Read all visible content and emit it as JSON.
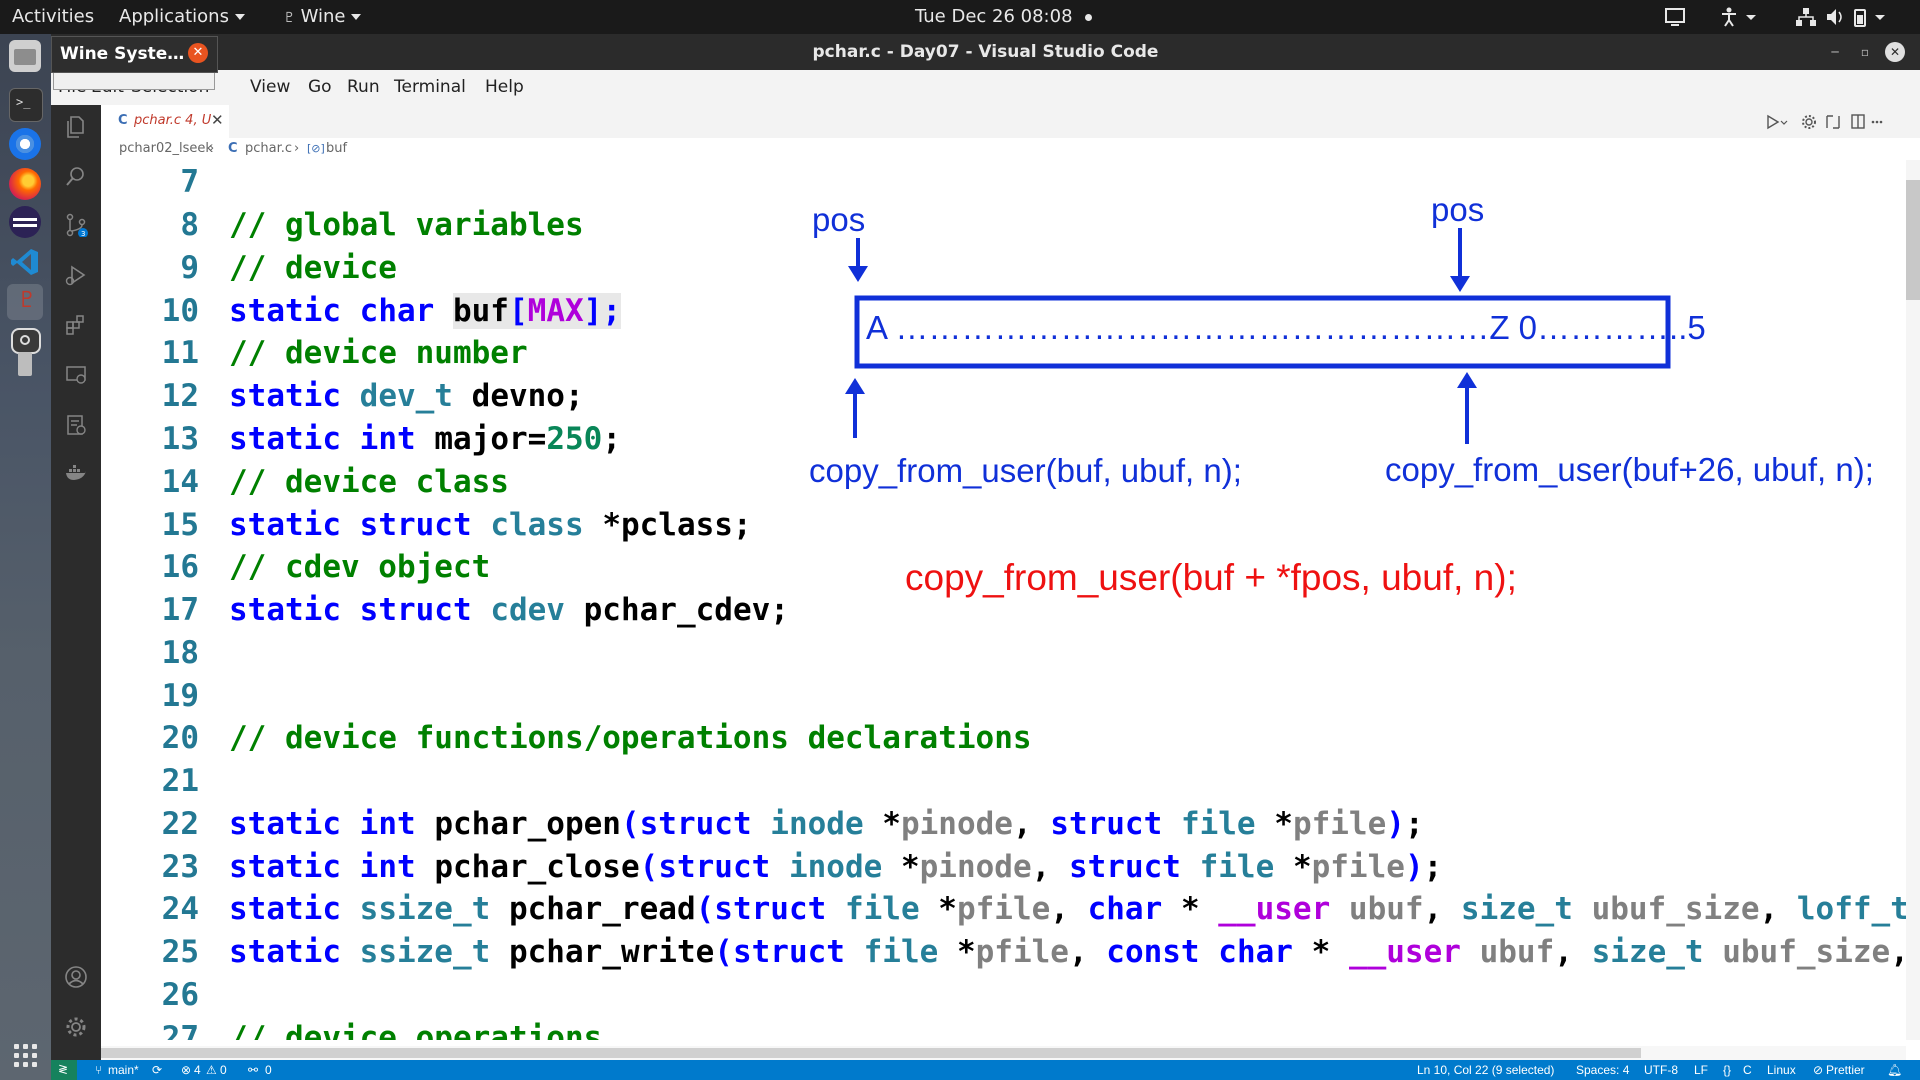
{
  "topbar": {
    "activities": "Activities",
    "applications": "Applications",
    "wine": "Wine",
    "clock": "Tue Dec 26  08:08"
  },
  "wine_popup": {
    "title": "Wine Syste…"
  },
  "window": {
    "title": "pchar.c - Day07 - Visual Studio Code"
  },
  "menu": [
    "File",
    "Edit",
    "Selection",
    "View",
    "Go",
    "Run",
    "Terminal",
    "Help"
  ],
  "tab": {
    "icon": "C",
    "name": "pchar.c 4, U"
  },
  "breadcrumb": {
    "folder": "pchar02_lseek",
    "file_icon": "C",
    "file": "pchar.c",
    "symbol": "buf"
  },
  "code": {
    "line_numbers": [
      "7",
      "8",
      "9",
      "10",
      "11",
      "12",
      "13",
      "14",
      "15",
      "16",
      "17",
      "18",
      "19",
      "20",
      "21",
      "22",
      "23",
      "24",
      "25",
      "26",
      "27"
    ],
    "line8": "// global variables",
    "line9": "// device",
    "line10": [
      "static",
      "char",
      "buf",
      "[",
      "MAX",
      "];"
    ],
    "line11": "// device number",
    "line12": [
      "static",
      "dev_t",
      "devno;"
    ],
    "line13": [
      "static",
      "int",
      "major=",
      "250",
      ";"
    ],
    "line14": "// device class",
    "line15": [
      "static",
      "struct",
      "class",
      "*pclass;"
    ],
    "line16": "// cdev object",
    "line17": [
      "static",
      "struct",
      "cdev",
      "pchar_cdev;"
    ],
    "line20": "// device functions/operations declarations",
    "line22": [
      "static",
      "int",
      "pchar_open",
      "(",
      "struct",
      "inode",
      "*",
      "pinode",
      ", ",
      "struct",
      "file",
      "*",
      "pfile",
      ")",
      ";"
    ],
    "line23": [
      "static",
      "int",
      "pchar_close",
      "(",
      "struct",
      "inode",
      "*",
      "pinode",
      ", ",
      "struct",
      "file",
      "*",
      "pfile",
      ")",
      ";"
    ],
    "line24": [
      "static",
      "ssize_t",
      "pchar_read",
      "(",
      "struct",
      "file",
      "*",
      "pfile",
      ", ",
      "char",
      "* ",
      "__user",
      "ubuf",
      ", ",
      "size_t",
      "ubuf_size",
      ", ",
      "loff_t"
    ],
    "line25": [
      "static",
      "ssize_t",
      "pchar_write",
      "(",
      "struct",
      "file",
      "*",
      "pfile",
      ", ",
      "const",
      "char",
      "* ",
      "__user",
      "ubuf",
      ", ",
      "size_t",
      "ubuf_size",
      ","
    ],
    "line27": "// device operations"
  },
  "annotations": {
    "pos_left": "pos",
    "pos_right": "pos",
    "buffer_text": "A ………………………………………………Z 0…………..5",
    "copy_left": "copy_from_user(buf, ubuf, n);",
    "copy_right": "copy_from_user(buf+26, ubuf, n);",
    "copy_general": "copy_from_user(buf + *fpos, ubuf, n);"
  },
  "statusbar": {
    "branch": "main*",
    "errors": "4",
    "warnings": "0",
    "ports": "0",
    "position": "Ln 10, Col 22 (9 selected)",
    "spaces": "Spaces: 4",
    "encoding": "UTF-8",
    "eol": "LF",
    "language": "C",
    "os": "Linux",
    "formatter": "Prettier"
  },
  "colors": {
    "keyword": "#0000ff",
    "type": "#267f99",
    "comment": "#008000",
    "line_number": "#237893",
    "annotation_blue": "#1030d8",
    "annotation_red": "#ee1111",
    "statusbar": "#007acc"
  }
}
